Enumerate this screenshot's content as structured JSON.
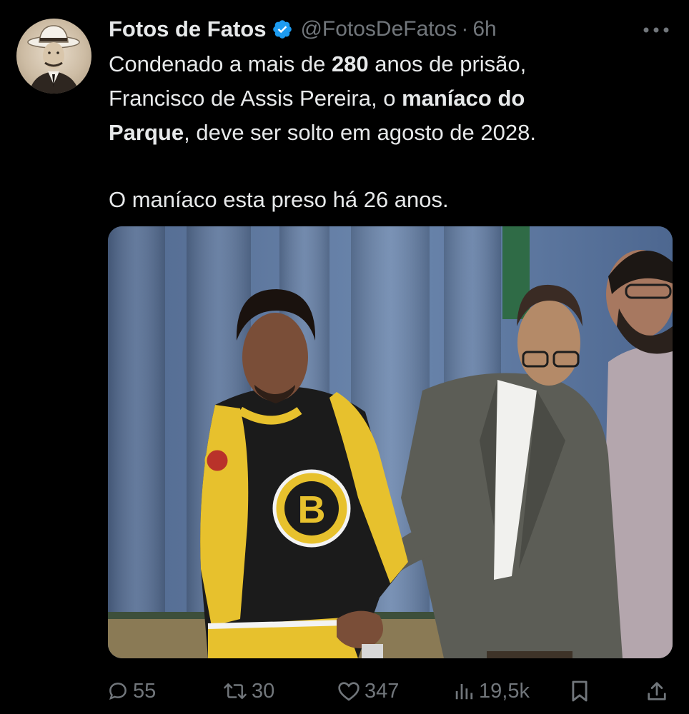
{
  "colors": {
    "background": "#000000",
    "text_primary": "#e7e9ea",
    "text_secondary": "#71767b",
    "verified_blue": "#1d9bf0"
  },
  "author": {
    "display_name": "Fotos de Fatos",
    "verified_icon": "verified-badge-icon",
    "handle": "@FotosDeFatos",
    "separator": "·",
    "time": "6h"
  },
  "tweet": {
    "line1_pre": "Condenado a mais de ",
    "line1_bold": "280",
    "line1_post": " anos de prisão,",
    "line2_pre": "Francisco de Assis Pereira, o ",
    "line2_bold": "maníaco do",
    "line3_bold": "Parque",
    "line3_post": ", deve ser solto em agosto de 2028.",
    "line4": "O maníaco esta preso há 26 anos."
  },
  "actions": {
    "reply_count": "55",
    "retweet_count": "30",
    "like_count": "347",
    "views_count": "19,5k"
  }
}
